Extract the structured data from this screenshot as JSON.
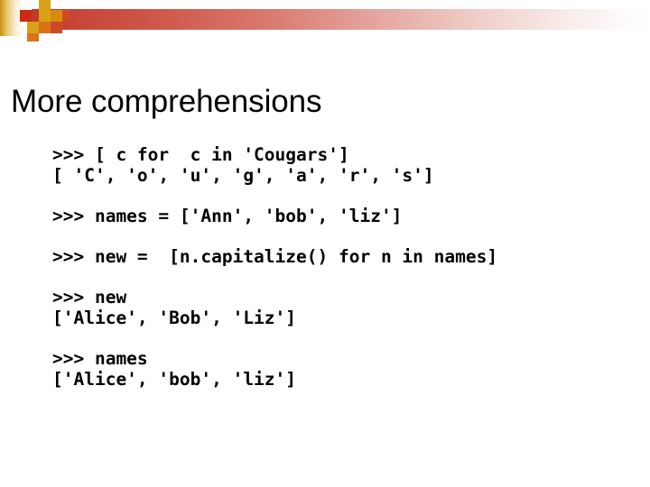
{
  "slide": {
    "title": "More comprehensions",
    "background_color": "#ffffff",
    "text_color": "#000000"
  },
  "decoration": {
    "accent_red": "#c0392b",
    "accent_gold": "#d8a117",
    "accent_orange": "#d9731a",
    "accent_deep_red": "#cc2a12",
    "squares": [
      {
        "name": "square-red-left",
        "color": "#cc2a12"
      },
      {
        "name": "square-gold-top",
        "color": "#d8a117"
      },
      {
        "name": "square-gold-mid",
        "color": "#d8a117"
      },
      {
        "name": "square-gold-lower",
        "color": "#d8a117"
      },
      {
        "name": "square-amber-right",
        "color": "#d88a10"
      },
      {
        "name": "square-orange-center",
        "color": "#d9731a"
      },
      {
        "name": "square-red-right",
        "color": "#cf4a24"
      },
      {
        "name": "square-orange-bottom",
        "color": "#d9731a"
      },
      {
        "name": "square-red-far",
        "color": "#cf4a24"
      }
    ]
  },
  "code": {
    "groups": [
      {
        "name": "comprehension-over-string",
        "lines": [
          ">>> [ c for  c in 'Cougars']",
          "[ 'C', 'o', 'u', 'g', 'a', 'r', 's']"
        ]
      },
      {
        "name": "names-assignment",
        "lines": [
          ">>> names = ['Ann', 'bob', 'liz']"
        ]
      },
      {
        "name": "new-comprehension",
        "lines": [
          ">>> new =  [n.capitalize() for n in names]"
        ]
      },
      {
        "name": "new-output",
        "lines": [
          ">>> new",
          "['Alice', 'Bob', 'Liz']"
        ]
      },
      {
        "name": "names-output",
        "lines": [
          ">>> names",
          "['Alice', 'bob', 'liz']"
        ]
      }
    ]
  }
}
